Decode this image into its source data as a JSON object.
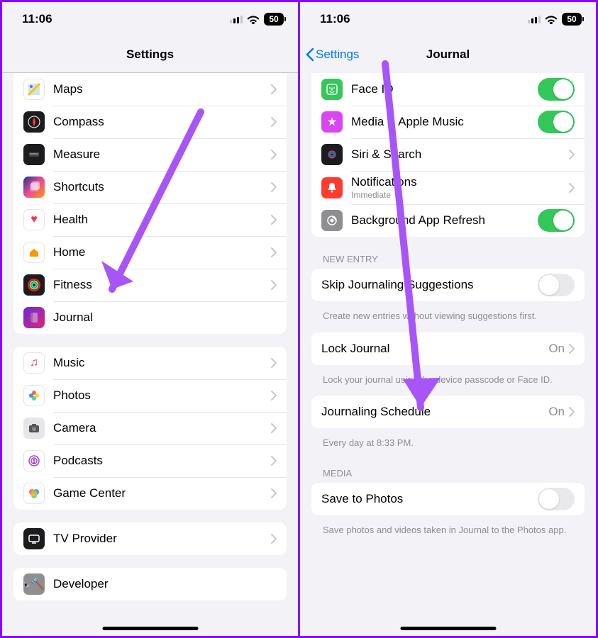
{
  "status": {
    "time": "11:06",
    "battery": "50"
  },
  "left": {
    "title": "Settings",
    "group1": [
      {
        "key": "maps",
        "label": "Maps"
      },
      {
        "key": "compass",
        "label": "Compass"
      },
      {
        "key": "measure",
        "label": "Measure"
      },
      {
        "key": "shortcuts",
        "label": "Shortcuts"
      },
      {
        "key": "health",
        "label": "Health"
      },
      {
        "key": "home",
        "label": "Home"
      },
      {
        "key": "fitness",
        "label": "Fitness"
      },
      {
        "key": "journal",
        "label": "Journal"
      }
    ],
    "group2": [
      {
        "key": "music",
        "label": "Music"
      },
      {
        "key": "photos",
        "label": "Photos"
      },
      {
        "key": "camera",
        "label": "Camera"
      },
      {
        "key": "podcasts",
        "label": "Podcasts"
      },
      {
        "key": "gamecenter",
        "label": "Game Center"
      }
    ],
    "group3": [
      {
        "key": "tv",
        "label": "TV Provider"
      }
    ],
    "group4": [
      {
        "key": "dev",
        "label": "Developer"
      }
    ]
  },
  "right": {
    "back": "Settings",
    "title": "Journal",
    "permissions": [
      {
        "key": "faceid",
        "label": "Face ID",
        "toggle": true
      },
      {
        "key": "media",
        "label": "Media & Apple Music",
        "toggle": true
      },
      {
        "key": "siri",
        "label": "Siri & Search",
        "nav": true
      },
      {
        "key": "notifications",
        "label": "Notifications",
        "sub": "Immediate",
        "nav": true
      },
      {
        "key": "bgapp",
        "label": "Background App Refresh",
        "toggle": true
      }
    ],
    "newEntryHeader": "NEW ENTRY",
    "skip": {
      "label": "Skip Journaling Suggestions",
      "toggle": false
    },
    "skipFooter": "Create new entries without viewing suggestions first.",
    "lock": {
      "label": "Lock Journal",
      "value": "On"
    },
    "lockFooter": "Lock your journal using the device passcode or Face ID.",
    "schedule": {
      "label": "Journaling Schedule",
      "value": "On"
    },
    "scheduleFooter": "Every day at 8:33 PM.",
    "mediaHeader": "MEDIA",
    "save": {
      "label": "Save to Photos",
      "toggle": false
    },
    "saveFooter": "Save photos and videos taken in Journal to the Photos app."
  }
}
